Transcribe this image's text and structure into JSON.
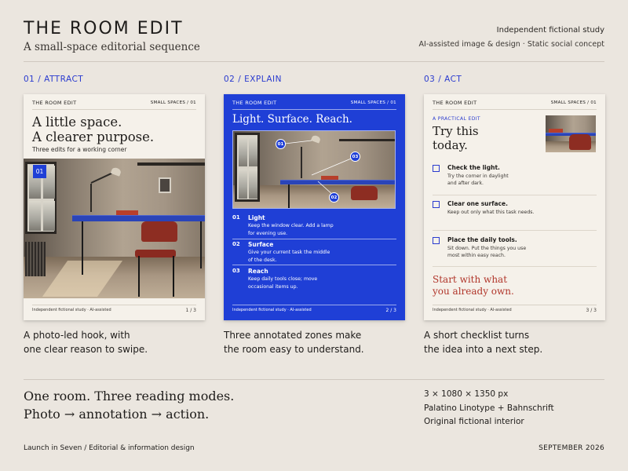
{
  "header": {
    "title": "THE ROOM EDIT",
    "subtitle": "A small-space editorial sequence",
    "meta_line1": "Independent fictional study",
    "meta_line2": "AI-assisted image & design · Static social concept"
  },
  "sections": [
    {
      "label": "01 / ATTRACT",
      "caption_line1": "A photo-led hook, with",
      "caption_line2": "one clear reason to swipe."
    },
    {
      "label": "02 / EXPLAIN",
      "caption_line1": "Three annotated zones make",
      "caption_line2": "the room easy to understand."
    },
    {
      "label": "03 / ACT",
      "caption_line1": "A short checklist turns",
      "caption_line2": "the idea into a next step."
    }
  ],
  "card_common": {
    "brand": "THE ROOM EDIT",
    "series": "SMALL SPACES / 01",
    "footer_note": "Independent fictional study · AI-assisted"
  },
  "card1": {
    "headline_line1": "A little space.",
    "headline_line2": "A clearer purpose.",
    "subhead": "Three edits for a working corner",
    "badge": "01",
    "page": "1 / 3"
  },
  "card2": {
    "headline": "Light. Surface. Reach.",
    "pins": [
      "01",
      "03",
      "02"
    ],
    "items": [
      {
        "num": "01",
        "title": "Light",
        "desc_line1": "Keep the window clear. Add a lamp",
        "desc_line2": "for evening use."
      },
      {
        "num": "02",
        "title": "Surface",
        "desc_line1": "Give your current task the middle",
        "desc_line2": "of the desk."
      },
      {
        "num": "03",
        "title": "Reach",
        "desc_line1": "Keep daily tools close; move",
        "desc_line2": "occasional items up."
      }
    ],
    "page": "2 / 3"
  },
  "card3": {
    "kicker": "A PRACTICAL EDIT",
    "headline_line1": "Try this",
    "headline_line2": "today.",
    "items": [
      {
        "title": "Check the light.",
        "desc_line1": "Try the corner in daylight",
        "desc_line2": "and after dark."
      },
      {
        "title": "Clear one surface.",
        "desc_line1": "Keep out only what this task needs.",
        "desc_line2": ""
      },
      {
        "title": "Place the daily tools.",
        "desc_line1": "Sit down. Put the things you use",
        "desc_line2": "most within easy reach."
      }
    ],
    "closing_line1": "Start with what",
    "closing_line2": "you already own.",
    "page": "3 / 3"
  },
  "summary": {
    "line1": "One room. Three reading modes.",
    "line2": "Photo → annotation → action."
  },
  "specs": [
    "3 × 1080 × 1350 px",
    "Palatino Linotype + Bahnschrift",
    "Original fictional interior"
  ],
  "footer": {
    "left": "Launch in Seven / Editorial & information design",
    "right": "SEPTEMBER 2026"
  },
  "colors": {
    "background": "#ebe6df",
    "accent_blue": "#1f3fd6",
    "accent_red": "#b1362b",
    "card_paper": "#f5f1ea"
  }
}
